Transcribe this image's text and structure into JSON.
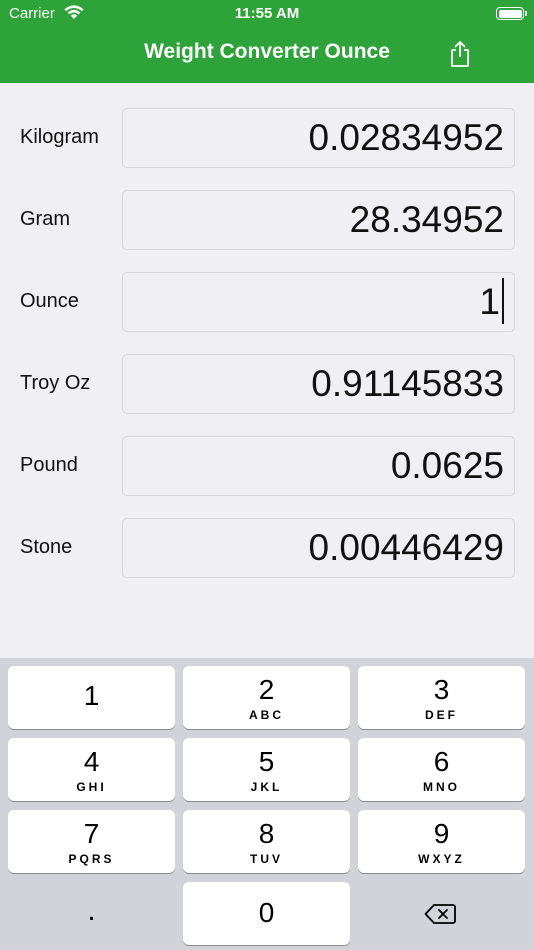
{
  "status_bar": {
    "carrier": "Carrier",
    "time": "11:55 AM"
  },
  "nav": {
    "title": "Weight Converter Ounce",
    "share_icon": "share-icon"
  },
  "colors": {
    "nav_bg": "#2EA33A",
    "page_bg": "#EFEFF4",
    "keyboard_bg": "#D1D3D9"
  },
  "units": [
    {
      "label": "Kilogram",
      "value": "0.02834952"
    },
    {
      "label": "Gram",
      "value": "28.34952"
    },
    {
      "label": "Ounce",
      "value": "1"
    },
    {
      "label": "Troy Oz",
      "value": "0.91145833"
    },
    {
      "label": "Pound",
      "value": "0.0625"
    },
    {
      "label": "Stone",
      "value": "0.00446429"
    }
  ],
  "keyboard": {
    "keys": [
      {
        "num": "1",
        "letters": ""
      },
      {
        "num": "2",
        "letters": "ABC"
      },
      {
        "num": "3",
        "letters": "DEF"
      },
      {
        "num": "4",
        "letters": "GHI"
      },
      {
        "num": "5",
        "letters": "JKL"
      },
      {
        "num": "6",
        "letters": "MNO"
      },
      {
        "num": "7",
        "letters": "PQRS"
      },
      {
        "num": "8",
        "letters": "TUV"
      },
      {
        "num": "9",
        "letters": "WXYZ"
      }
    ],
    "decimal": ".",
    "zero": "0",
    "delete_icon": "backspace-icon"
  }
}
